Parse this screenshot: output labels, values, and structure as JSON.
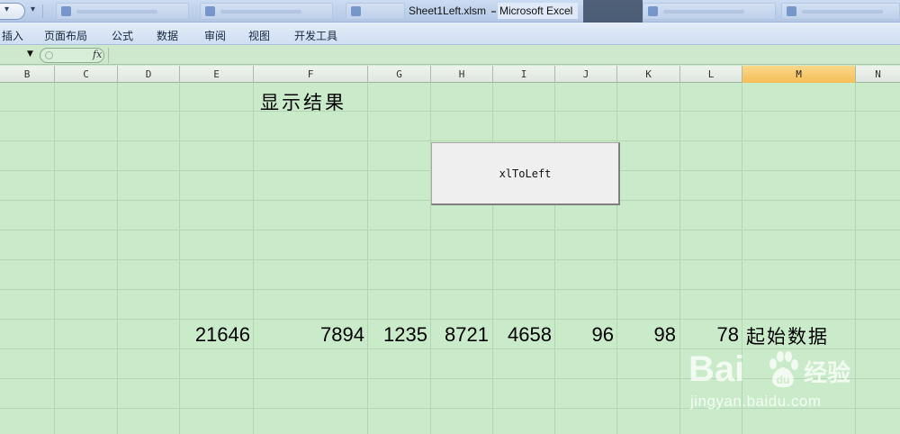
{
  "titlebar": {
    "filename": "Sheet1Left.xlsm",
    "app_name": "Microsoft Excel"
  },
  "ribbon": {
    "tabs": [
      "插入",
      "页面布局",
      "公式",
      "数据",
      "审阅",
      "视图",
      "开发工具"
    ]
  },
  "formula_bar": {
    "fx_label": "fx",
    "content": ""
  },
  "columns": [
    "B",
    "C",
    "D",
    "E",
    "F",
    "G",
    "H",
    "I",
    "J",
    "K",
    "L",
    "M",
    "N"
  ],
  "selected_column": "M",
  "sheet": {
    "heading": "显示结果",
    "data_row": [
      "21646",
      "7894",
      "1235",
      "8721",
      "4658",
      "96",
      "98",
      "78"
    ],
    "row_label": "起始数据"
  },
  "macro_button": {
    "label": "xlToLeft"
  },
  "watermark": {
    "brand": "Bai",
    "product": "经验",
    "url": "jingyan.baidu.com"
  }
}
